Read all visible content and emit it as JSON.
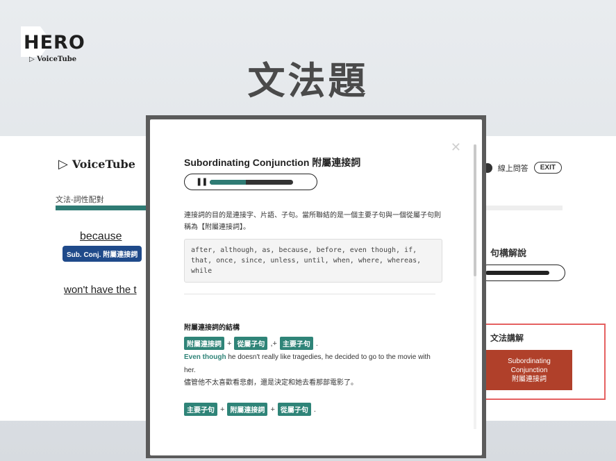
{
  "slide": {
    "logo_main": "HERO",
    "logo_sub": "VoiceTube",
    "title": "文法題"
  },
  "app": {
    "brand": "VoiceTube",
    "breadcrumb": "文法-詞性配對",
    "progress": 0.19,
    "keyword": "because",
    "keyword_tag": "Sub. Conj. 附屬連接詞",
    "sentence_fragment": "won't have the t",
    "qa_label": "線上問答",
    "exit_label": "EXIT",
    "sentence_explain": "句構解說",
    "grammar_label": "文法講解",
    "grammar_card": [
      "Subordinating",
      "Conjunction",
      "附屬連接詞"
    ]
  },
  "modal": {
    "title": "Subordinating Conjunction 附屬連接詞",
    "audio_progress": 0.43,
    "intro": "連接詞的目的是連接字、片語、子句。當所聯結的是一個主要子句與一個從屬子句則稱為【附屬連接詞】。",
    "conjunctions": "after, although, as, because, before, even though, if, that, once, since, unless, until, when, where, whereas, while",
    "structure_title": "附屬連接詞的結構",
    "formula1": [
      "附屬連接詞",
      "+",
      "從屬子句",
      ",+",
      "主要子句",
      "."
    ],
    "example1_highlight": "Even though",
    "example1_rest": " he doesn't really like tragedies, he decided to go to the movie with her.",
    "example1_zh": "儘管他不太喜歡看悲劇，還是決定和她去看那部電影了。",
    "formula2": [
      "主要子句",
      "+",
      "附屬連接詞",
      "+",
      "從屬子句",
      "."
    ]
  },
  "colors": {
    "accent_teal": "#2f8478",
    "card_red": "#b0402a",
    "highlight_border": "#e56060"
  }
}
